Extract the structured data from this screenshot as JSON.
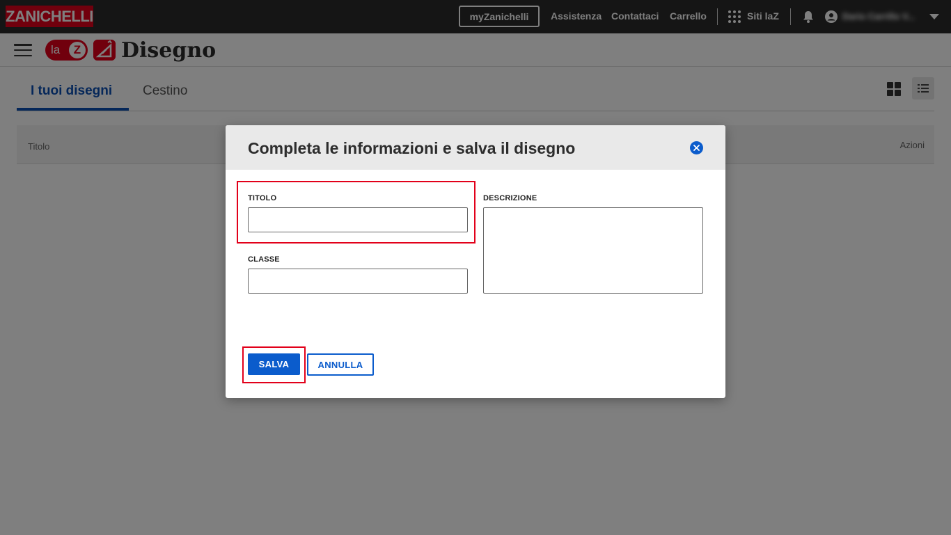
{
  "topbar": {
    "brand": "ZANICHELLI",
    "my_button": "myZanichelli",
    "links": [
      "Assistenza",
      "Contattaci",
      "Carrello"
    ],
    "sites_label": "Siti laZ",
    "user_name": "Dario Carrillo V..."
  },
  "appbar": {
    "laz_text": "la",
    "laz_z": "Z",
    "title": "Disegno"
  },
  "page": {
    "tabs": [
      {
        "label": "I tuoi disegni",
        "active": true
      },
      {
        "label": "Cestino",
        "active": false
      }
    ],
    "table": {
      "col_title": "Titolo",
      "col_actions": "Azioni"
    }
  },
  "modal": {
    "title": "Completa le informazioni e salva il disegno",
    "fields": {
      "titolo_label": "TITOLO",
      "titolo_value": "",
      "classe_label": "CLASSE",
      "classe_value": "",
      "descrizione_label": "DESCRIZIONE",
      "descrizione_value": ""
    },
    "save_label": "SALVA",
    "cancel_label": "ANNULLA"
  },
  "colors": {
    "brand_red": "#e2001a",
    "primary_blue": "#0b5ccc",
    "topbar_bg": "#2a2a2a",
    "highlight": "#e2001a"
  },
  "icons": [
    "menu-icon",
    "bell-icon",
    "user-icon",
    "apps-grid-icon",
    "close-icon",
    "grid-view-icon",
    "list-view-icon",
    "chevron-down-icon"
  ]
}
